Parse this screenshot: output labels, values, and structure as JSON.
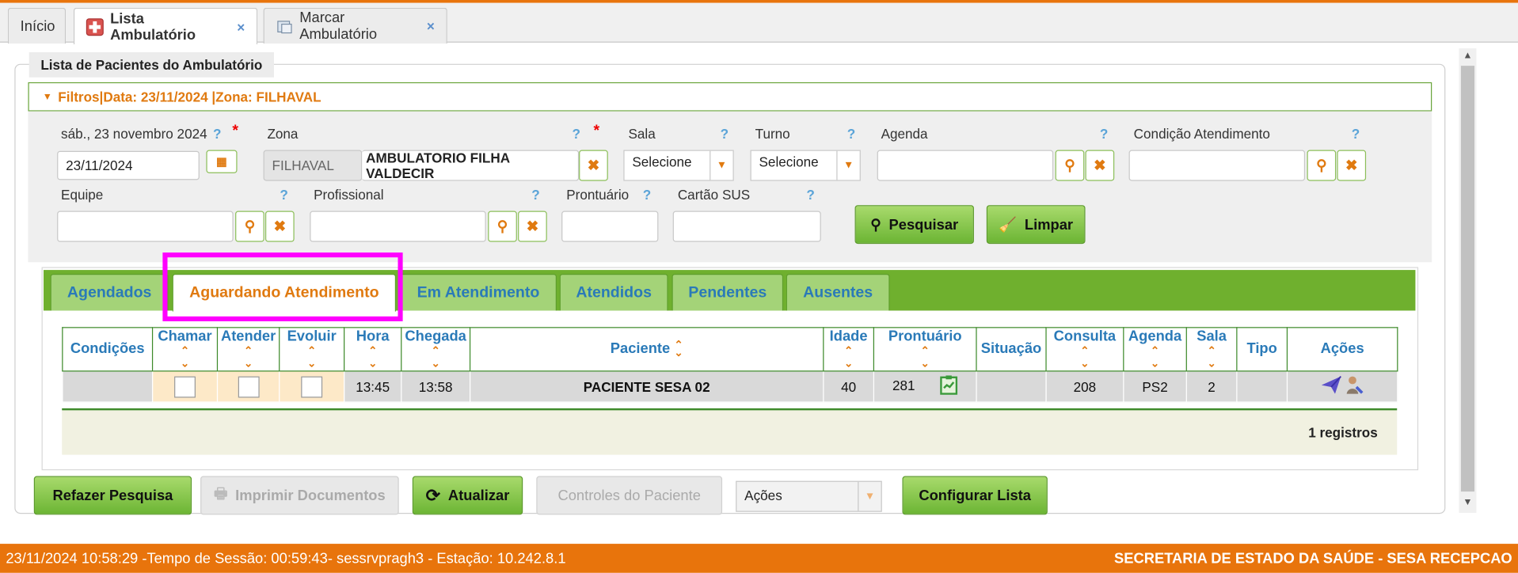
{
  "window_tabs": [
    {
      "label": "Início"
    },
    {
      "label": "Lista Ambulatório",
      "close": "×"
    },
    {
      "label": "Marcar Ambulatório",
      "close": "×"
    }
  ],
  "panel_title": "Lista de Pacientes do Ambulatório",
  "filter_bar": "Filtros|Data: 23/11/2024 |Zona: FILHAVAL",
  "filters": {
    "date_label": "sáb., 23 novembro 2024",
    "date_value": "23/11/2024",
    "zona_label": "Zona",
    "zona_code": "FILHAVAL",
    "zona_name": "AMBULATORIO FILHA VALDECIR",
    "sala_label": "Sala",
    "sala_value": "Selecione",
    "turno_label": "Turno",
    "turno_value": "Selecione",
    "agenda_label": "Agenda",
    "condicao_label": "Condição Atendimento",
    "equipe_label": "Equipe",
    "profissional_label": "Profissional",
    "prontuario_label": "Prontuário",
    "cartao_label": "Cartão SUS",
    "help": "?",
    "required": "*",
    "pesquisar": "Pesquisar",
    "limpar": "Limpar"
  },
  "list_tabs": [
    "Agendados",
    "Aguardando Atendimento",
    "Em Atendimento",
    "Atendidos",
    "Pendentes",
    "Ausentes"
  ],
  "active_tab": "Aguardando Atendimento",
  "table": {
    "columns": [
      "Condições",
      "Chamar",
      "Atender",
      "Evoluir",
      "Hora",
      "Chegada",
      "Paciente",
      "Idade",
      "Prontuário",
      "Situação",
      "Consulta",
      "Agenda",
      "Sala",
      "Tipo",
      "Ações"
    ],
    "rows": [
      {
        "hora": "13:45",
        "chegada": "13:58",
        "paciente": "PACIENTE SESA 02",
        "idade": "40",
        "prontuario": "281",
        "consulta": "208",
        "agenda": "PS2",
        "sala": "2"
      }
    ],
    "records": "1 registros"
  },
  "bottom_buttons": {
    "refazer": "Refazer Pesquisa",
    "imprimir": "Imprimir Documentos",
    "atualizar": "Atualizar",
    "controles": "Controles do Paciente",
    "acoes": "Ações",
    "configurar": "Configurar Lista"
  },
  "status": {
    "left": "23/11/2024 10:58:29 -Tempo de Sessão: 00:59:43- sessrvpragh3 - Estação: 10.242.8.1",
    "right": "SECRETARIA DE ESTADO DA SAÚDE - SESA RECEPCAO"
  },
  "colors": {
    "accent": "#e8740c",
    "green": "#6fb02e",
    "link_blue": "#2a7ab8",
    "highlight": "#ff00ff"
  }
}
